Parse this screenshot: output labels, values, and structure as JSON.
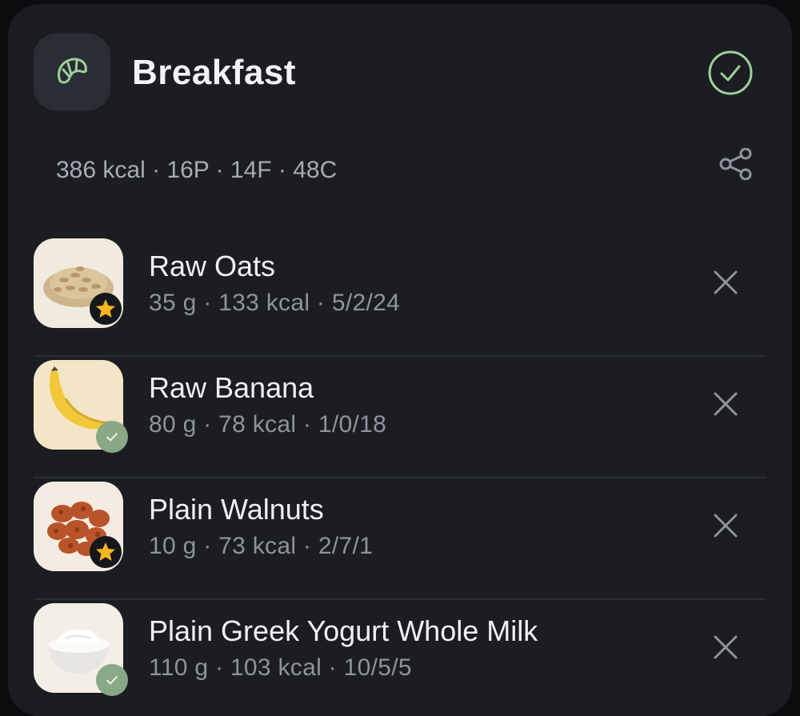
{
  "meal": {
    "title": "Breakfast",
    "icon": "croissant-icon",
    "summary": "386 kcal · 16P · 14F · 48C",
    "accent_color": "#9fcf9a"
  },
  "actions": {
    "done_icon": "check-circle-icon",
    "share_icon": "share-icon",
    "remove_icon": "close-icon"
  },
  "foods": [
    {
      "name": "Raw Oats",
      "meta": "35 g · 133 kcal · 5/2/24",
      "badge": "star-icon",
      "image": "oats"
    },
    {
      "name": "Raw Banana",
      "meta": "80 g · 78 kcal · 1/0/18",
      "badge": "check-badge-icon",
      "image": "banana"
    },
    {
      "name": "Plain Walnuts",
      "meta": "10 g · 73 kcal · 2/7/1",
      "badge": "star-icon",
      "image": "walnuts"
    },
    {
      "name": "Plain Greek Yogurt Whole Milk",
      "meta": "110 g · 103 kcal · 10/5/5",
      "badge": "check-badge-icon",
      "image": "yogurt"
    }
  ]
}
